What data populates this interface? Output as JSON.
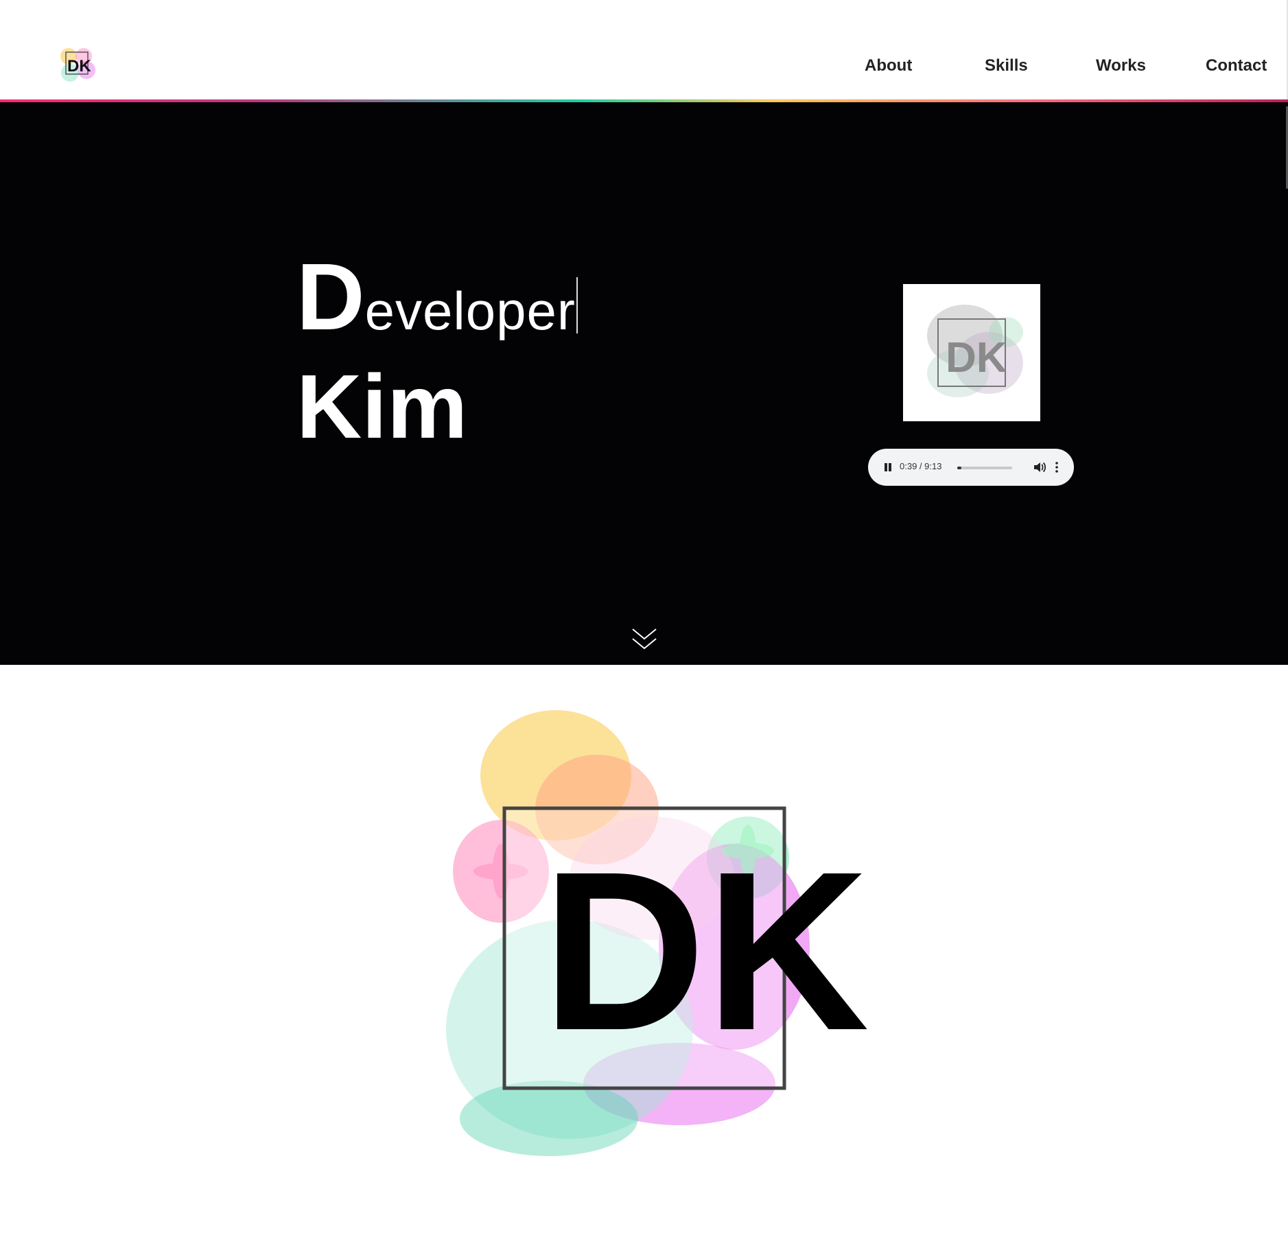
{
  "header": {
    "logo_text": "DK",
    "nav": [
      {
        "label": "About"
      },
      {
        "label": "Skills"
      },
      {
        "label": "Works"
      },
      {
        "label": "Contact"
      }
    ]
  },
  "hero": {
    "title_initial": "D",
    "title_rest": "eveloper",
    "subtitle": "Kim",
    "album_logo_text": "DK",
    "audio": {
      "current_time": "0:39",
      "duration": "9:13",
      "time_display": "0:39 / 9:13",
      "progress": 0.071
    },
    "scroll_icon": "chevron-double-down-icon"
  },
  "logo_section": {
    "logo_text": "DK"
  },
  "colors": {
    "hero_bg": "#030306",
    "nav_text": "#222222",
    "accent_pink": "#ff5fa2",
    "accent_green": "#5fe3a1",
    "accent_yellow": "#f9c846",
    "accent_magenta": "#e040e8"
  }
}
